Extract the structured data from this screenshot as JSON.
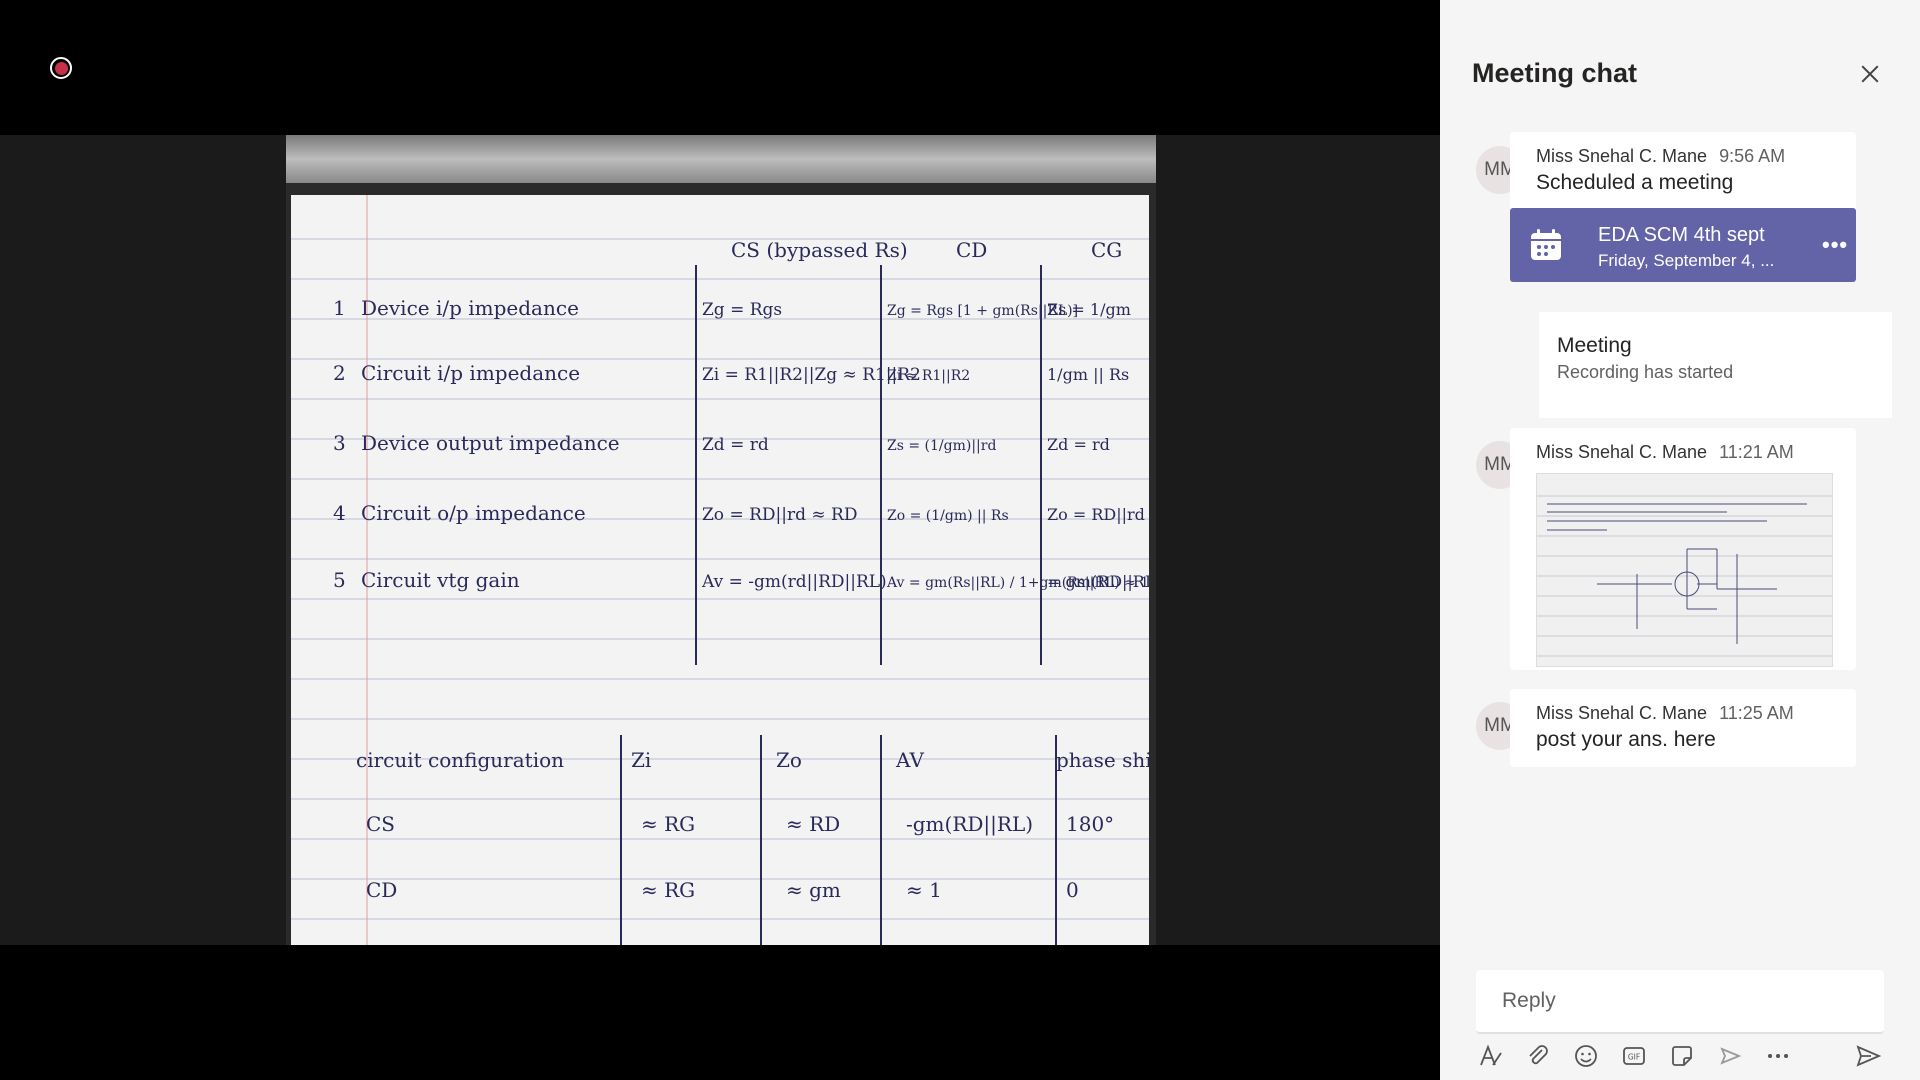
{
  "meeting": {
    "recording_indicator": "recording-icon"
  },
  "chat": {
    "title": "Meeting chat",
    "messages": [
      {
        "initials": "MM",
        "author": "Miss Snehal C. Mane",
        "time": "9:56 AM",
        "text": "Scheduled a meeting",
        "card": {
          "title": "EDA SCM 4th sept",
          "subtitle": "Friday, September 4, ..."
        }
      },
      {
        "initials": "MM",
        "author": "Miss Snehal C. Mane",
        "time": "11:21 AM",
        "image": "circuit-problem-image"
      },
      {
        "initials": "MM",
        "author": "Miss Snehal C. Mane",
        "time": "11:25 AM",
        "text": "post your ans. here"
      }
    ],
    "system": {
      "heading": "Meeting",
      "text": "Recording has started"
    },
    "reply_placeholder": "Reply",
    "toolbar": [
      "format-icon",
      "attach-icon",
      "emoji-icon",
      "gif-icon",
      "sticker-icon",
      "meet-now-icon",
      "more-options-icon",
      "send-icon"
    ]
  },
  "shared_content": {
    "header": [
      "CS (bypassed Rs)",
      "CD",
      "CG"
    ],
    "rows": [
      {
        "n": "1",
        "label": "Device i/p impedance",
        "cs": "Zg = Rgs",
        "cd": "Zg = Rgs [1 + gm(Rs||RL)]",
        "cg": "Zs = 1/gm"
      },
      {
        "n": "2",
        "label": "Circuit i/p impedance",
        "cs": "Zi = R1||R2||Zg ≈ R1||R2",
        "cd": "Zi ≈ R1||R2",
        "cg": "1/gm || Rs"
      },
      {
        "n": "3",
        "label": "Device output impedance",
        "cs": "Zd = rd",
        "cd": "Zs = (1/gm)||rd",
        "cg": "Zd = rd"
      },
      {
        "n": "4",
        "label": "Circuit o/p impedance",
        "cs": "Zo = RD||rd ≈ RD",
        "cd": "Zo = (1/gm) || Rs",
        "cg": "Zo = RD||rd"
      },
      {
        "n": "5",
        "label": "Circuit vtg gain",
        "cs": "Av = -gm(rd||RD||RL)",
        "cd": "Av = gm(Rs||RL) / 1+gm(Rs||RL) ≈ 1",
        "cg": "= gm(RD||RL)"
      }
    ],
    "table2_header": [
      "circuit configuration",
      "Zi",
      "Zo",
      "AV",
      "phase shift"
    ],
    "table2_rows": [
      [
        "CS",
        "≈ RG",
        "≈ RD",
        "-gm(RD||RL)",
        "180°"
      ],
      [
        "CD",
        "≈ RG",
        "≈ gm",
        "≈ 1",
        "0"
      ]
    ]
  }
}
